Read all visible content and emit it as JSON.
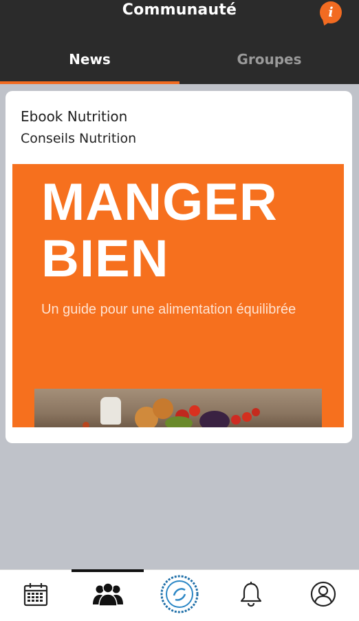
{
  "header": {
    "title": "Communauté",
    "info_icon": "info-icon"
  },
  "tabs": [
    {
      "label": "News",
      "active": true
    },
    {
      "label": "Groupes",
      "active": false
    }
  ],
  "post": {
    "title": "Ebook Nutrition",
    "subtitle": "Conseils Nutrition",
    "cover": {
      "line1": "MANGER",
      "line2": "BIEN",
      "tagline": "Un guide pour une alimentation équilibrée"
    }
  },
  "bottom_nav": [
    {
      "icon": "calendar-icon",
      "active": false
    },
    {
      "icon": "community-icon",
      "active": true
    },
    {
      "icon": "center-logo-icon",
      "active": false
    },
    {
      "icon": "bell-icon",
      "active": false
    },
    {
      "icon": "profile-icon",
      "active": false
    }
  ],
  "colors": {
    "accent": "#f26b21",
    "header_bg": "#2b2b2b",
    "page_bg": "#bfc2c9"
  }
}
